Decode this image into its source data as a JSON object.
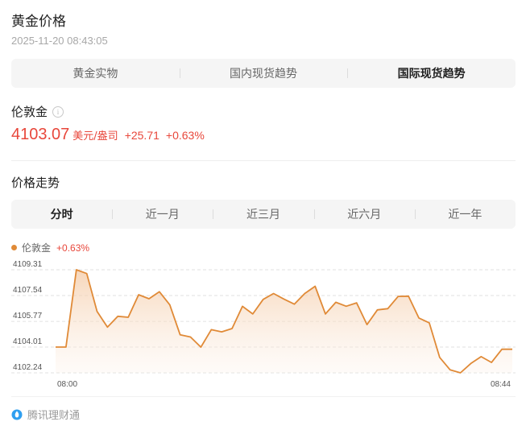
{
  "header": {
    "title": "黄金价格",
    "timestamp": "2025-11-20 08:43:05"
  },
  "tabs": [
    {
      "label": "黄金实物",
      "active": false
    },
    {
      "label": "国内现货趋势",
      "active": false
    },
    {
      "label": "国际现货趋势",
      "active": true
    }
  ],
  "quote": {
    "name": "伦敦金",
    "info_icon": "info-icon",
    "price": "4103.07",
    "unit": "美元/盎司",
    "change": "+25.71",
    "change_pct": "+0.63%",
    "color": "#e8473b"
  },
  "trend": {
    "title": "价格走势",
    "ranges": [
      {
        "label": "分时",
        "active": true
      },
      {
        "label": "近一月",
        "active": false
      },
      {
        "label": "近三月",
        "active": false
      },
      {
        "label": "近六月",
        "active": false
      },
      {
        "label": "近一年",
        "active": false
      }
    ]
  },
  "chart_data": {
    "type": "area",
    "legend": {
      "name": "伦敦金",
      "change": "+0.63%"
    },
    "line_color": "#e08a37",
    "y_ticks": [
      "4109.31",
      "4107.54",
      "4105.77",
      "4104.01",
      "4102.24"
    ],
    "ylim": [
      4102.24,
      4109.31
    ],
    "x_tick_labels": [
      "08:00",
      "08:44"
    ],
    "x_range": [
      0,
      44
    ],
    "grid": true,
    "values": [
      4104.01,
      4104.01,
      4109.31,
      4109.05,
      4106.45,
      4105.37,
      4106.12,
      4106.05,
      4107.6,
      4107.32,
      4107.8,
      4106.9,
      4104.85,
      4104.7,
      4104.0,
      4105.2,
      4105.05,
      4105.28,
      4106.8,
      4106.28,
      4107.28,
      4107.68,
      4107.3,
      4106.95,
      4107.68,
      4108.18,
      4106.28,
      4107.08,
      4106.81,
      4107.04,
      4105.55,
      4106.56,
      4106.64,
      4107.48,
      4107.5,
      4106.0,
      4105.67,
      4103.3,
      4102.45,
      4102.24,
      4102.88,
      4103.35,
      4102.95,
      4103.86,
      4103.86
    ]
  },
  "footer": {
    "source": "腾讯理财通",
    "icon": "tencent-licaitong-logo"
  }
}
